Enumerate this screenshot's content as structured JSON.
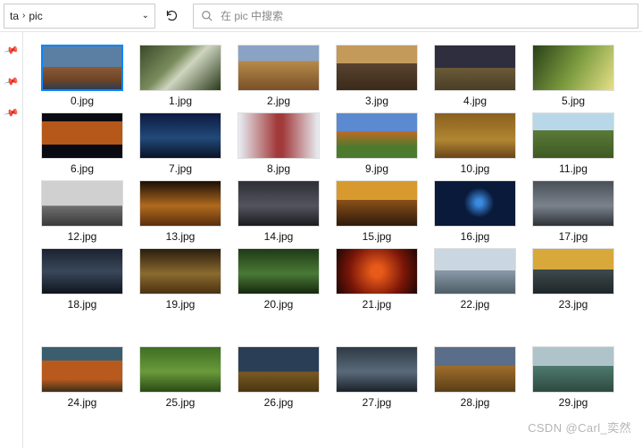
{
  "breadcrumb": {
    "seg0": "ta",
    "seg1": "pic"
  },
  "search": {
    "placeholder": "在 pic 中搜索"
  },
  "files": {
    "f0": "0.jpg",
    "f1": "1.jpg",
    "f2": "2.jpg",
    "f3": "3.jpg",
    "f4": "4.jpg",
    "f5": "5.jpg",
    "f6": "6.jpg",
    "f7": "7.jpg",
    "f8": "8.jpg",
    "f9": "9.jpg",
    "f10": "10.jpg",
    "f11": "11.jpg",
    "f12": "12.jpg",
    "f13": "13.jpg",
    "f14": "14.jpg",
    "f15": "15.jpg",
    "f16": "16.jpg",
    "f17": "17.jpg",
    "f18": "18.jpg",
    "f19": "19.jpg",
    "f20": "20.jpg",
    "f21": "21.jpg",
    "f22": "22.jpg",
    "f23": "23.jpg",
    "f24": "24.jpg",
    "f25": "25.jpg",
    "f26": "26.jpg",
    "f27": "27.jpg",
    "f28": "28.jpg",
    "f29": "29.jpg"
  },
  "thumbs": {
    "t0": "linear-gradient(to bottom,#5a7fa3 48%,#8c5a37 48%,#6b4326 80%,#2a3d56)",
    "t1": "linear-gradient(135deg,#3a4a2a,#7a8c5c 40%,#cfd5c0 55%,#2a3a1a)",
    "t2": "linear-gradient(to bottom,#8aa2c4 35%,#b68a4a 35%,#7a5028)",
    "t3": "linear-gradient(to bottom,#c49a5a 40%,#5a4230 40%,#3a2a1a)",
    "t4": "linear-gradient(to bottom,#2e2e3e 50%,#6a5a38 50%,#4a3e26)",
    "t5": "linear-gradient(120deg,#2a4018,#7a9a3e 50%,#e6e088)",
    "t6": "linear-gradient(to bottom,#0a0a12 18%,#b5581a 18% 70%,#0a0a12 70%)",
    "t7": "linear-gradient(to bottom,#0e1a40,#214a7a 55%,#0a1228)",
    "t8": "linear-gradient(to right,#e8eef4,#a23a3a 48% 55%,#e8eef4)",
    "t9": "linear-gradient(to bottom,#5c8ad0 40%,#c06a24 40%,#4c7a2e 75%)",
    "t10": "linear-gradient(to bottom,#8a6020,#b08632 60%,#6a4418)",
    "t11": "linear-gradient(to bottom,#b8d8ea 38%,#5a7a3a 38%,#3e5a22)",
    "t12": "linear-gradient(to bottom,#d0d0d0 55%,#707070 55%,#3a3a3a)",
    "t13": "linear-gradient(to bottom,#1a0e06,#b06a1e 55%,#5a2e0e)",
    "t14": "linear-gradient(to bottom,#2e2e36,#54545e 55%,#1a1a20)",
    "t15": "linear-gradient(to bottom,#d89a2e 42%,#8a5018 42%,#2e1a0a)",
    "t16": "radial-gradient(circle at 55% 48%,#3a8ae0 6%,#0a1a3a 30%)",
    "t17": "linear-gradient(to bottom,#4a5058,#7a828c 55%,#2e3238)",
    "t18": "linear-gradient(to bottom,#1a2230,#3a485a 50%,#0e141e)",
    "t19": "linear-gradient(to bottom,#2a1e0e,#8a6a2e 55%,#4a3212)",
    "t20": "linear-gradient(to bottom,#1e3a16,#4a7a36 55%,#16280e)",
    "t21": "radial-gradient(circle at 50% 50%,#e85a1a 12%,#7a1608 60%,#1e0604)",
    "t22": "linear-gradient(to bottom,#cad6e0 48%,#8a9aa8 48%,#4e5e66)",
    "t23": "linear-gradient(to bottom,#d8a83a 46%,#3e4a4e 46%,#1e2628)",
    "t24": "linear-gradient(to bottom,#3a5e6e 30%,#b85a1e 30% 72%,#3a2e1a)",
    "t25": "linear-gradient(to bottom,#3e6e22,#6a9a3a 55%,#2a4a16)",
    "t26": "linear-gradient(to bottom,#2a3e56 55%,#7a5a22 55%,#4a3612)",
    "t27": "linear-gradient(to bottom,#2e3a46,#5a6a7a 55%,#1a222a)",
    "t28": "linear-gradient(to bottom,#5a6e8a 42%,#a06e2a 42%,#5a3e18)",
    "t29": "linear-gradient(to bottom,#aec4ca 42%,#4e7a6e 42%,#2e4a40)"
  },
  "watermark": "CSDN @Carl_奕然"
}
